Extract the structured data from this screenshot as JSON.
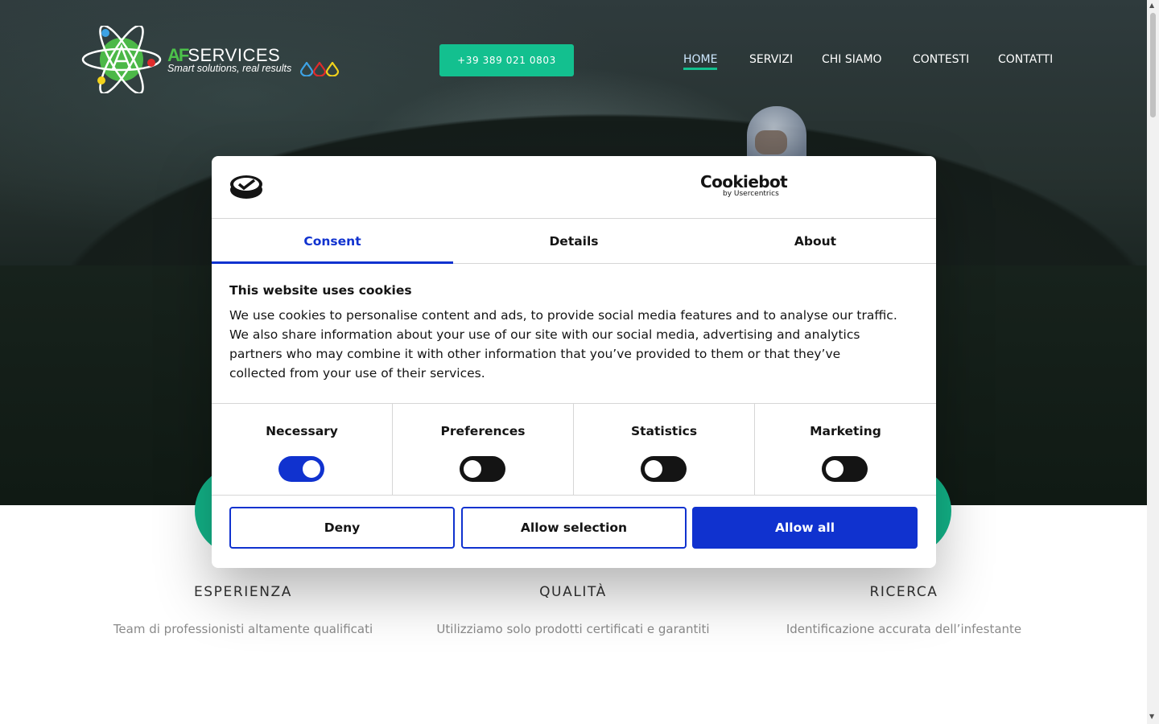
{
  "header": {
    "logo": {
      "brand_prefix": "AF",
      "brand_suffix": "SERVICES",
      "tagline": "Smart solutions, real results"
    },
    "phone_label": "+39 389 021 0803",
    "nav": {
      "items": [
        {
          "label": "HOME",
          "active": true
        },
        {
          "label": "SERVIZI",
          "active": false
        },
        {
          "label": "CHI SIAMO",
          "active": false
        },
        {
          "label": "CONTESTI",
          "active": false
        },
        {
          "label": "CONTATTI",
          "active": false
        }
      ]
    }
  },
  "features": [
    {
      "title": "ESPERIENZA",
      "text": "Team di professionisti altamente qualificati"
    },
    {
      "title": "QUALITÀ",
      "text": "Utilizziamo solo prodotti certificati e garantiti"
    },
    {
      "title": "RICERCA",
      "text": "Identificazione accurata dell’infestante"
    }
  ],
  "cookie_dialog": {
    "brand": "Cookiebot",
    "brand_sub": "by Usercentrics",
    "tabs": [
      {
        "label": "Consent",
        "active": true
      },
      {
        "label": "Details",
        "active": false
      },
      {
        "label": "About",
        "active": false
      }
    ],
    "title": "This website uses cookies",
    "text": "We use cookies to personalise content and ads, to provide social media features and to analyse our traffic. We also share information about your use of our site with our social media, advertising and analytics partners who may combine it with other information that you’ve provided to them or that they’ve collected from your use of their services.",
    "categories": [
      {
        "label": "Necessary",
        "enabled": true
      },
      {
        "label": "Preferences",
        "enabled": false
      },
      {
        "label": "Statistics",
        "enabled": false
      },
      {
        "label": "Marketing",
        "enabled": false
      }
    ],
    "buttons": {
      "deny": "Deny",
      "allow_selection": "Allow selection",
      "allow_all": "Allow all"
    }
  },
  "colors": {
    "accent_green": "#13c08f",
    "cookie_blue": "#1032cf",
    "text_dark": "#141414"
  }
}
